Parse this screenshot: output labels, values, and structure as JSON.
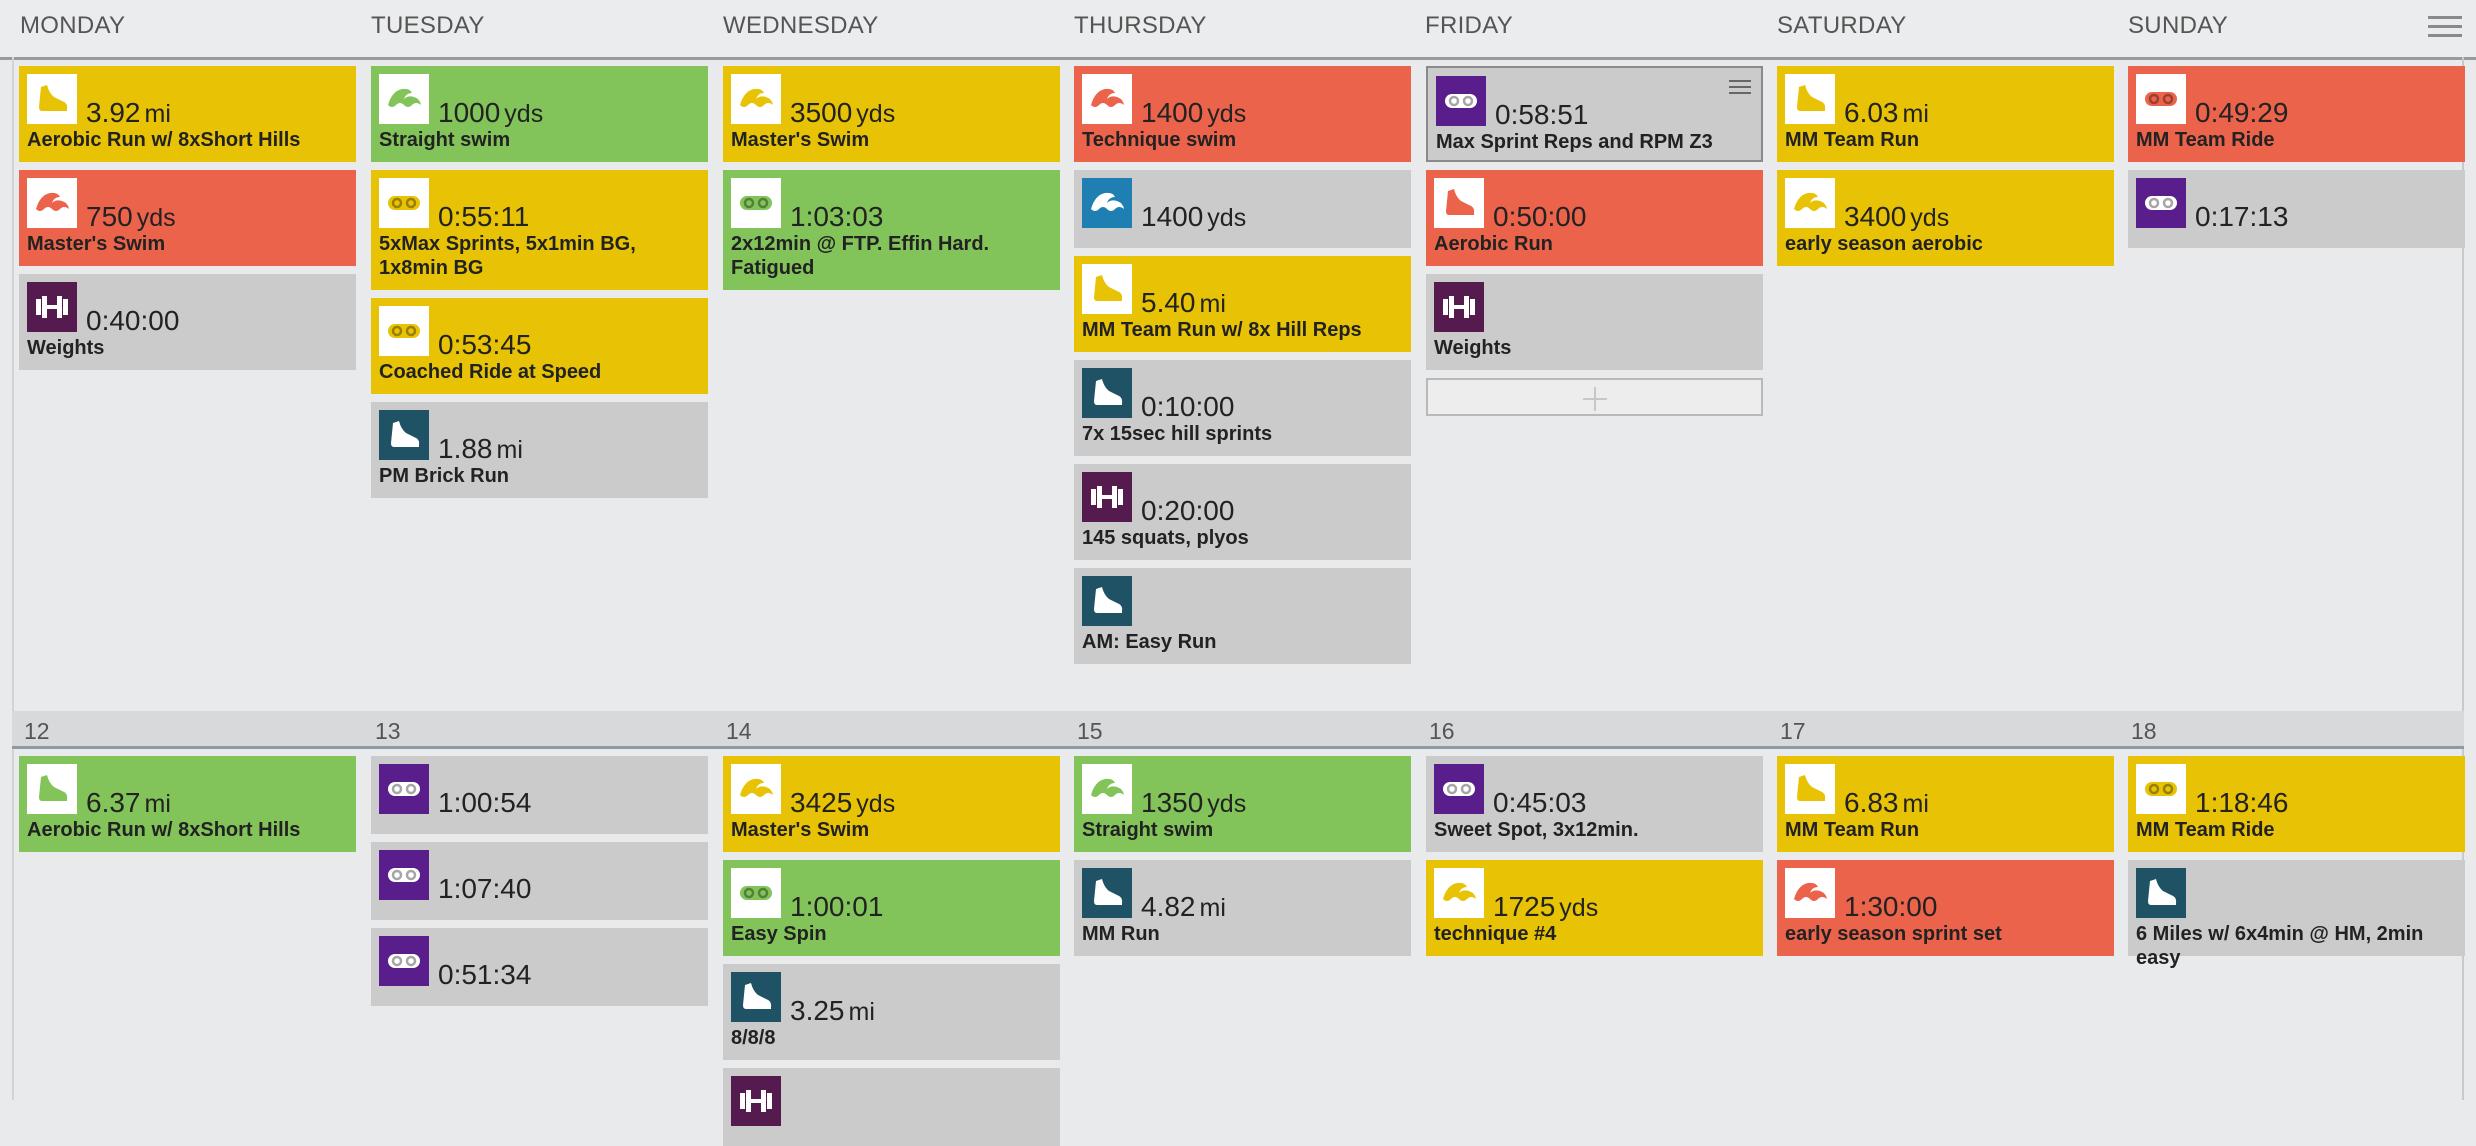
{
  "colors": {
    "yellow": "#e8c305",
    "green": "#82c45a",
    "red": "#ec634b",
    "gray": "#cbcbcb",
    "purple": "#5a1d8c",
    "teal": "#1e5264",
    "blue": "#1f7fb3",
    "plum": "#561b4e"
  },
  "days": [
    "MONDAY",
    "TUESDAY",
    "WEDNESDAY",
    "THURSDAY",
    "FRIDAY",
    "SATURDAY",
    "SUNDAY"
  ],
  "week2_dates": [
    "12",
    "13",
    "14",
    "15",
    "16",
    "17",
    "18"
  ],
  "week1": [
    [
      {
        "sport": "run",
        "color": "yellow",
        "value": "3.92",
        "unit": "mi",
        "title": "Aerobic Run w/ 8xShort Hills",
        "icon": "run-shoe-icon"
      },
      {
        "sport": "swim",
        "color": "red",
        "value": "750",
        "unit": "yds",
        "title": "Master's Swim",
        "icon": "swim-wave-icon"
      },
      {
        "sport": "strength",
        "color": "gray",
        "value": "0:40:00",
        "unit": "",
        "title": "Weights",
        "icon": "dumbbell-icon"
      }
    ],
    [
      {
        "sport": "swim",
        "color": "green",
        "value": "1000",
        "unit": "yds",
        "title": "Straight swim",
        "icon": "swim-wave-icon"
      },
      {
        "sport": "bike",
        "color": "yellow",
        "value": "0:55:11",
        "unit": "",
        "title": "5xMax Sprints, 5x1min BG, 1x8min BG",
        "icon": "bike-chain-icon"
      },
      {
        "sport": "bike",
        "color": "yellow",
        "value": "0:53:45",
        "unit": "",
        "title": "Coached Ride at Speed",
        "icon": "bike-chain-icon"
      },
      {
        "sport": "run",
        "color": "gray",
        "value": "1.88",
        "unit": "mi",
        "title": "PM Brick Run",
        "icon": "run-shoe-icon"
      }
    ],
    [
      {
        "sport": "swim",
        "color": "yellow",
        "value": "3500",
        "unit": "yds",
        "title": "Master's Swim",
        "icon": "swim-wave-icon"
      },
      {
        "sport": "bike",
        "color": "green",
        "value": "1:03:03",
        "unit": "",
        "title": "2x12min @ FTP. Effin Hard. Fatigued",
        "icon": "bike-chain-icon"
      }
    ],
    [
      {
        "sport": "swim",
        "color": "red",
        "value": "1400",
        "unit": "yds",
        "title": "Technique swim",
        "icon": "swim-wave-icon"
      },
      {
        "sport": "swim",
        "color": "gray",
        "value": "1400",
        "unit": "yds",
        "title": "",
        "icon": "swim-wave-icon"
      },
      {
        "sport": "run",
        "color": "yellow",
        "value": "5.40",
        "unit": "mi",
        "title": "MM Team Run w/ 8x Hill Reps",
        "icon": "run-shoe-icon"
      },
      {
        "sport": "run",
        "color": "gray",
        "value": "0:10:00",
        "unit": "",
        "title": "7x 15sec hill sprints",
        "icon": "run-shoe-icon"
      },
      {
        "sport": "strength",
        "color": "gray",
        "value": "0:20:00",
        "unit": "",
        "title": "145 squats, plyos",
        "icon": "dumbbell-icon"
      },
      {
        "sport": "run",
        "color": "gray",
        "value": "",
        "unit": "",
        "title": "AM: Easy Run",
        "icon": "run-shoe-icon"
      }
    ],
    [
      {
        "sport": "bike",
        "color": "gray",
        "value": "0:58:51",
        "unit": "",
        "title": "Max Sprint Reps and RPM Z3",
        "icon": "bike-chain-icon",
        "selected": true
      },
      {
        "sport": "run",
        "color": "red",
        "value": "0:50:00",
        "unit": "",
        "title": "Aerobic Run",
        "icon": "run-shoe-icon"
      },
      {
        "sport": "strength",
        "color": "gray",
        "value": "",
        "unit": "",
        "title": "Weights",
        "icon": "dumbbell-icon"
      }
    ],
    [
      {
        "sport": "run",
        "color": "yellow",
        "value": "6.03",
        "unit": "mi",
        "title": "MM Team Run",
        "icon": "run-shoe-icon"
      },
      {
        "sport": "swim",
        "color": "yellow",
        "value": "3400",
        "unit": "yds",
        "title": "early season aerobic",
        "icon": "swim-wave-icon"
      }
    ],
    [
      {
        "sport": "bike",
        "color": "red",
        "value": "0:49:29",
        "unit": "",
        "title": "MM Team Ride",
        "icon": "bike-chain-icon"
      },
      {
        "sport": "bike",
        "color": "gray",
        "value": "0:17:13",
        "unit": "",
        "title": "",
        "icon": "bike-chain-icon"
      }
    ]
  ],
  "week2": [
    [
      {
        "sport": "run",
        "color": "green",
        "value": "6.37",
        "unit": "mi",
        "title": "Aerobic Run w/ 8xShort Hills",
        "icon": "run-shoe-icon"
      }
    ],
    [
      {
        "sport": "bike",
        "color": "gray",
        "value": "1:00:54",
        "unit": "",
        "title": "",
        "icon": "bike-chain-icon"
      },
      {
        "sport": "bike",
        "color": "gray",
        "value": "1:07:40",
        "unit": "",
        "title": "",
        "icon": "bike-chain-icon"
      },
      {
        "sport": "bike",
        "color": "gray",
        "value": "0:51:34",
        "unit": "",
        "title": "",
        "icon": "bike-chain-icon"
      }
    ],
    [
      {
        "sport": "swim",
        "color": "yellow",
        "value": "3425",
        "unit": "yds",
        "title": "Master's Swim",
        "icon": "swim-wave-icon"
      },
      {
        "sport": "bike",
        "color": "green",
        "value": "1:00:01",
        "unit": "",
        "title": "Easy Spin",
        "icon": "bike-chain-icon"
      },
      {
        "sport": "run",
        "color": "gray",
        "value": "3.25",
        "unit": "mi",
        "title": "8/8/8",
        "icon": "run-shoe-icon"
      },
      {
        "sport": "strength",
        "color": "gray",
        "value": "",
        "unit": "",
        "title": "",
        "icon": "dumbbell-icon"
      }
    ],
    [
      {
        "sport": "swim",
        "color": "green",
        "value": "1350",
        "unit": "yds",
        "title": "Straight swim",
        "icon": "swim-wave-icon"
      },
      {
        "sport": "run",
        "color": "gray",
        "value": "4.82",
        "unit": "mi",
        "title": "MM Run",
        "icon": "run-shoe-icon"
      }
    ],
    [
      {
        "sport": "bike",
        "color": "gray",
        "value": "0:45:03",
        "unit": "",
        "title": "Sweet Spot, 3x12min.",
        "icon": "bike-chain-icon"
      },
      {
        "sport": "swim",
        "color": "yellow",
        "value": "1725",
        "unit": "yds",
        "title": "technique #4",
        "icon": "swim-wave-icon"
      }
    ],
    [
      {
        "sport": "run",
        "color": "yellow",
        "value": "6.83",
        "unit": "mi",
        "title": "MM Team Run",
        "icon": "run-shoe-icon"
      },
      {
        "sport": "swim",
        "color": "red",
        "value": "1:30:00",
        "unit": "",
        "title": "early season sprint set",
        "icon": "swim-wave-icon"
      }
    ],
    [
      {
        "sport": "bike",
        "color": "yellow",
        "value": "1:18:46",
        "unit": "",
        "title": "MM Team Ride",
        "icon": "bike-chain-icon"
      },
      {
        "sport": "run",
        "color": "gray",
        "value": "",
        "unit": "",
        "title": "6 Miles w/ 6x4min @ HM, 2min easy",
        "icon": "run-shoe-icon"
      }
    ]
  ]
}
